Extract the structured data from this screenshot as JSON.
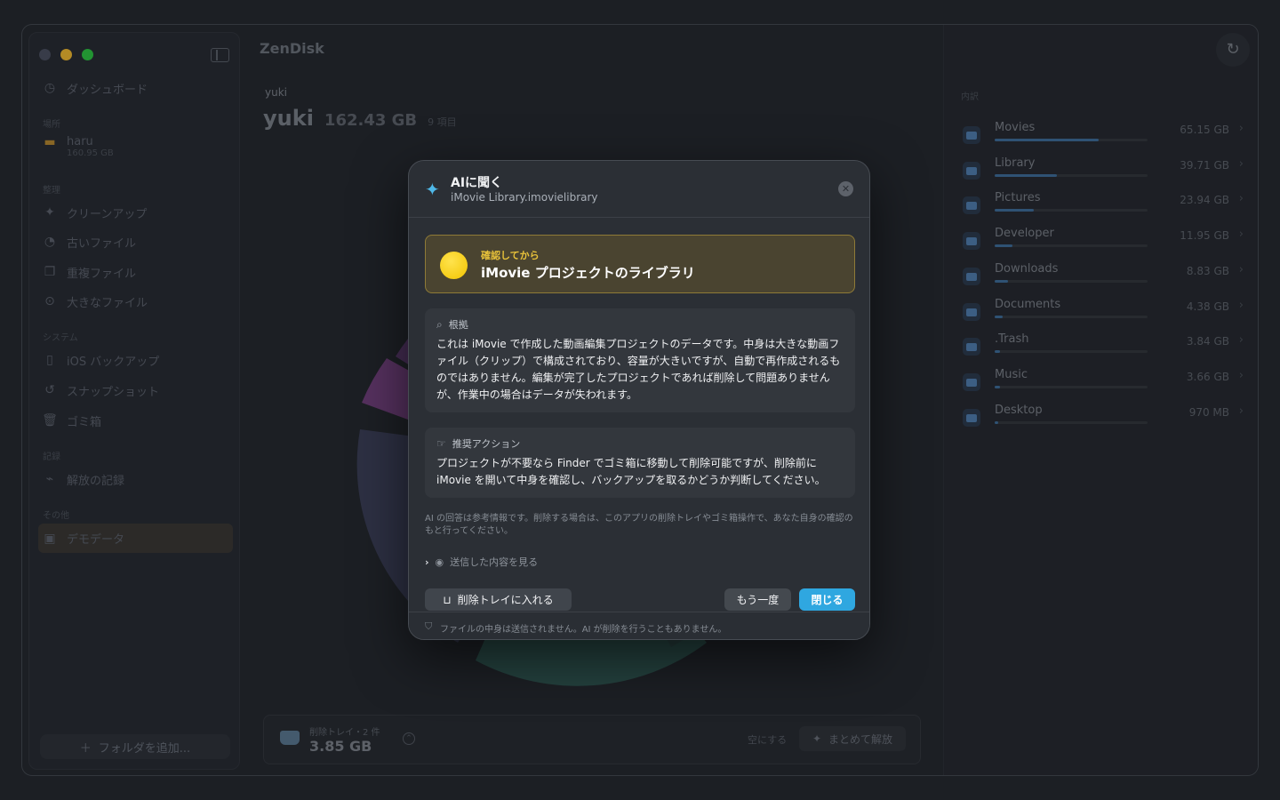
{
  "app": {
    "title": "ZenDisk"
  },
  "sidebar": {
    "dashboard": "ダッシュボード",
    "section_places": "場所",
    "place_name": "haru",
    "place_size": "160.95 GB",
    "section_organize": "整理",
    "organize_items": [
      "クリーンアップ",
      "古いファイル",
      "重複ファイル",
      "大きなファイル"
    ],
    "section_system": "システム",
    "system_items": [
      "iOS バックアップ",
      "スナップショット",
      "ゴミ箱"
    ],
    "section_records": "記録",
    "records_items": [
      "解放の記録"
    ],
    "section_other": "その他",
    "other_items": [
      "デモデータ"
    ],
    "add_folder": "フォルダを追加..."
  },
  "main": {
    "breadcrumb": "yuki",
    "name": "yuki",
    "size": "162.43 GB",
    "count": "9 項目"
  },
  "tray": {
    "label": "削除トレイ・2 件",
    "value": "3.85 GB",
    "empty": "空にする",
    "release": "まとめて解放"
  },
  "contents": {
    "heading": "内訳",
    "items": [
      {
        "name": "Movies",
        "size": "65.15 GB",
        "fraction": 0.4
      },
      {
        "name": "Library",
        "size": "39.71 GB",
        "fraction": 0.24
      },
      {
        "name": "Pictures",
        "size": "23.94 GB",
        "fraction": 0.15
      },
      {
        "name": "Developer",
        "size": "11.95 GB",
        "fraction": 0.07
      },
      {
        "name": "Downloads",
        "size": "8.83 GB",
        "fraction": 0.05
      },
      {
        "name": "Documents",
        "size": "4.38 GB",
        "fraction": 0.03
      },
      {
        "name": ".Trash",
        "size": "3.84 GB",
        "fraction": 0.02
      },
      {
        "name": "Music",
        "size": "3.66 GB",
        "fraction": 0.02
      },
      {
        "name": "Desktop",
        "size": "970 MB",
        "fraction": 0.01
      }
    ]
  },
  "dialog": {
    "title": "AIに聞く",
    "subtitle": "iMovie Library.imovielibrary",
    "verdict_tag": "確認してから",
    "verdict_title": "iMovie プロジェクトのライブラリ",
    "reason_head": "根拠",
    "reason_body": "これは iMovie で作成した動画編集プロジェクトのデータです。中身は大きな動画ファイル（クリップ）で構成されており、容量が大きいですが、自動で再作成されるものではありません。編集が完了したプロジェクトであれば削除して問題ありませんが、作業中の場合はデータが失われます。",
    "action_head": "推奨アクション",
    "action_body": "プロジェクトが不要なら Finder でゴミ箱に移動して削除可能ですが、削除前に iMovie を開いて中身を確認し、バックアップを取るかどうか判断してください。",
    "disclaimer": "AI の回答は参考情報です。削除する場合は、このアプリの削除トレイやゴミ箱操作で、あなた自身の確認のもと行ってください。",
    "sent_toggle": "送信した内容を見る",
    "btn_tray": "削除トレイに入れる",
    "btn_retry": "もう一度",
    "btn_close": "閉じる",
    "footer": "ファイルの中身は送信されません。AI が削除を行うこともありません。"
  },
  "colors": {
    "accent": "#2fa7e0",
    "verdict_bg": "#4a4430",
    "verdict_tag": "#e8c23a"
  }
}
